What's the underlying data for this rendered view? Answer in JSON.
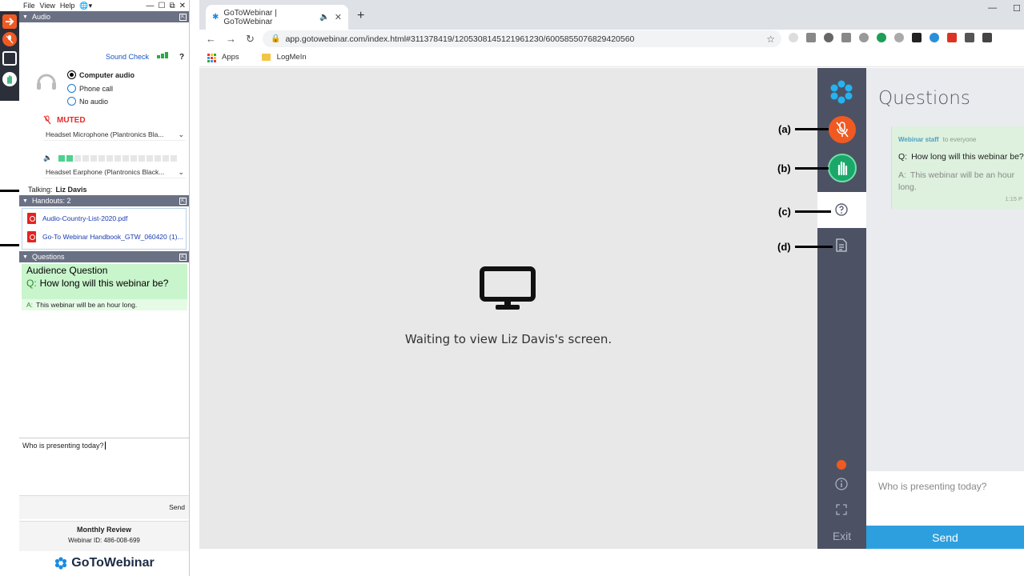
{
  "left_panel": {
    "menu": [
      "File",
      "View",
      "Help"
    ],
    "audio_header": "Audio",
    "sound_check": "Sound Check",
    "help_mark": "?",
    "audio_options": [
      {
        "label": "Computer audio",
        "selected": true
      },
      {
        "label": "Phone call",
        "selected": false
      },
      {
        "label": "No audio",
        "selected": false
      }
    ],
    "muted_label": "MUTED",
    "microphone": "Headset Microphone (Plantronics Bla...",
    "speaker": "Headset Earphone (Plantronics Black...",
    "talking_label": "Talking:",
    "talking_name": "Liz Davis",
    "handouts_header": "Handouts: 2",
    "handouts": [
      "Audio-Country-List-2020.pdf",
      "Go-To Webinar Handbook_GTW_060420 (1)..."
    ],
    "questions_header": "Questions",
    "question_card": {
      "title": "Audience Question",
      "q_prefix": "Q:",
      "question": "How long will this webinar be?",
      "a_prefix": "A:",
      "answer": "This webinar will be an hour long."
    },
    "question_input": "Who is presenting today?",
    "send_label": "Send",
    "webinar_title": "Monthly Review",
    "webinar_id": "Webinar ID: 486-008-699",
    "brand": "GoToWebinar"
  },
  "browser": {
    "tab_title": "GoToWebinar | GoToWebinar",
    "url": "app.gotowebinar.com/index.html#311378419/1205308145121961230/6005855076829420560",
    "bookmarks": [
      "Apps",
      "LogMeIn"
    ]
  },
  "viewer": {
    "waiting_text": "Waiting to view Liz Davis's screen."
  },
  "rail": {
    "exit_label": "Exit"
  },
  "questions_panel": {
    "title": "Questions",
    "sender": "Webinar staff",
    "audience": "to everyone",
    "q_prefix": "Q:",
    "question": "How long will this webinar be?",
    "a_prefix": "A:",
    "answer": "This webinar will be an hour long.",
    "time": "1:15 P",
    "input_placeholder": "Who is presenting today?",
    "send_label": "Send"
  },
  "callouts": [
    "(a)",
    "(b)",
    "(c)",
    "(d)"
  ],
  "colors": {
    "rail": "#4c5264",
    "mute_orange": "#f05a22",
    "hand_green": "#1aa86a",
    "send_blue": "#2e9fde",
    "question_green": "#c9f5cc"
  }
}
